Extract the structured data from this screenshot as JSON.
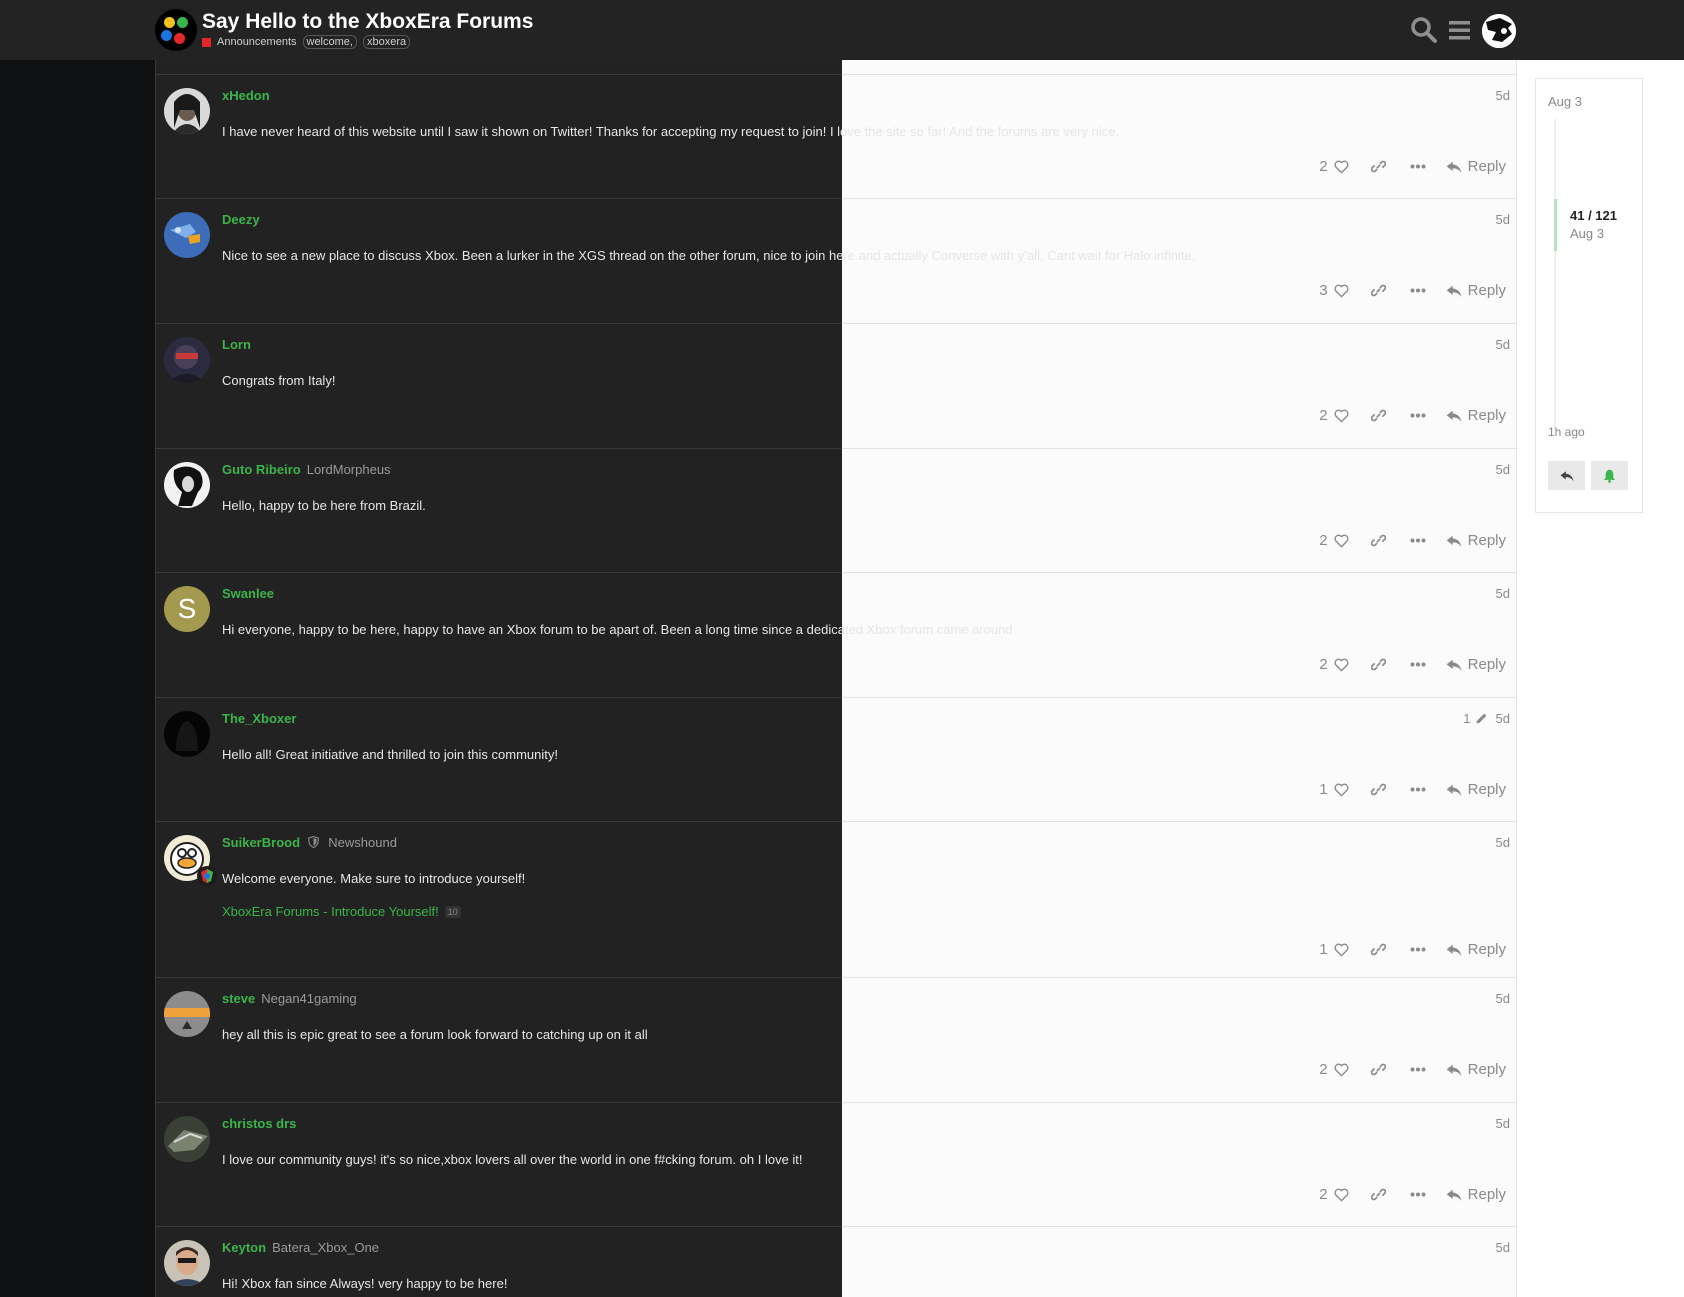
{
  "header": {
    "title": "Say Hello to the XboxEra Forums",
    "category": "Announcements",
    "tags": [
      "welcome,",
      "xboxera"
    ]
  },
  "colors": {
    "username": "#3ab54a",
    "category": "#e3262b",
    "accent_green": "#3ab54a"
  },
  "posts": [
    {
      "username": "xHedon",
      "user_title": "",
      "date": "5d",
      "body": "I have never heard of this website until I saw it shown on Twitter! Thanks for accepting my request to join! I love the site so far! And the forums are very nice.",
      "likes": "2",
      "reply": "Reply"
    },
    {
      "username": "Deezy",
      "user_title": "",
      "date": "5d",
      "body": "Nice to see a new place to discuss Xbox. Been a lurker in the XGS thread on the other forum, nice to join here and actually Converse with y’all. Cant wait for Halo infinite.",
      "likes": "3",
      "reply": "Reply"
    },
    {
      "username": "Lorn",
      "user_title": "",
      "date": "5d",
      "body": "Congrats from Italy!",
      "likes": "2",
      "reply": "Reply"
    },
    {
      "username": "Guto Ribeiro",
      "user_title": "LordMorpheus",
      "date": "5d",
      "body": "Hello, happy to be here from Brazil.",
      "likes": "2",
      "reply": "Reply"
    },
    {
      "username": "Swanlee",
      "user_title": "",
      "date": "5d",
      "avatar_letter": "S",
      "body": "Hi everyone, happy to be here, happy to have an Xbox forum to be apart of. Been a long time since a dedicated Xbox forum came around",
      "likes": "2",
      "reply": "Reply"
    },
    {
      "username": "The_Xboxer",
      "user_title": "",
      "date": "5d",
      "edits": "1",
      "body": "Hello all! Great initiative and thrilled to join this community!",
      "likes": "1",
      "reply": "Reply"
    },
    {
      "username": "SuikerBrood",
      "user_title": "Newshound",
      "date": "5d",
      "body": "Welcome everyone. Make sure to introduce yourself!",
      "link_text": "XboxEra Forums - Introduce Yourself!",
      "link_count": "10",
      "likes": "1",
      "reply": "Reply"
    },
    {
      "username": "steve",
      "user_title": "Negan41gaming",
      "date": "5d",
      "body": "hey all this is epic great to see a forum look forward to catching up on it all",
      "likes": "2",
      "reply": "Reply"
    },
    {
      "username": "christos drs",
      "user_title": "",
      "date": "5d",
      "body": "I love our community guys! it's so nice,xbox lovers all over the world in one f#cking forum. oh I love it!",
      "likes": "2",
      "reply": "Reply"
    },
    {
      "username": "Keyton",
      "user_title": "Batera_Xbox_One",
      "date": "5d",
      "body": "Hi! Xbox fan since Always! very happy to be here!",
      "likes": "",
      "reply": ""
    }
  ],
  "timeline": {
    "start_date": "Aug 3",
    "position": "41 / 121",
    "position_date": "Aug 3",
    "last_activity": "1h ago"
  }
}
